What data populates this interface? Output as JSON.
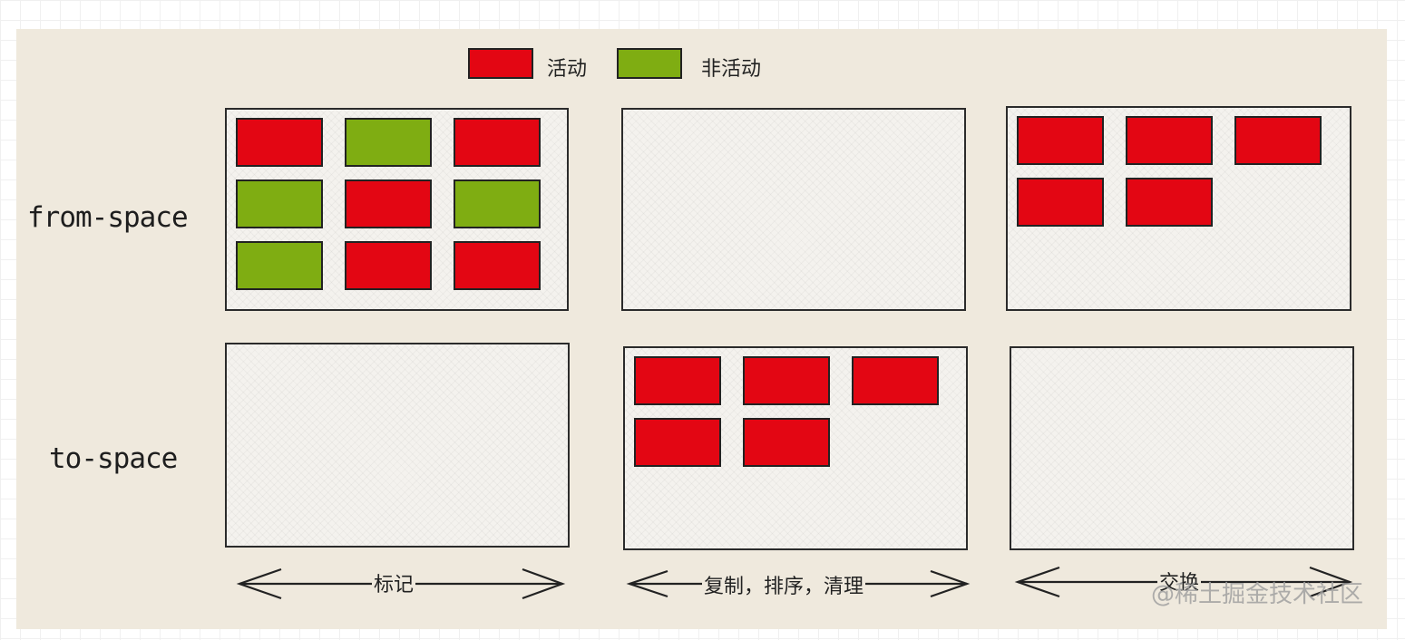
{
  "legend": [
    {
      "label": "活动",
      "color": "#e30613"
    },
    {
      "label": "非活动",
      "color": "#7fad12"
    }
  ],
  "rows": [
    "from-space",
    "to-space"
  ],
  "steps": [
    "标记",
    "复制，排序，清理",
    "交换"
  ],
  "colors": {
    "active": "#e30613",
    "inactive": "#7fad12",
    "background": "#efe9dd"
  },
  "panels": {
    "mark": {
      "from_space": [
        "active",
        "inactive",
        "active",
        "inactive",
        "active",
        "inactive",
        "inactive",
        "active",
        "active"
      ],
      "to_space": []
    },
    "copy": {
      "from_space": [],
      "to_space": [
        "active",
        "active",
        "active",
        "active",
        "active"
      ]
    },
    "swap": {
      "from_space": [
        "active",
        "active",
        "active",
        "active",
        "active"
      ],
      "to_space": []
    }
  },
  "watermark": "@稀土掘金技术社区"
}
